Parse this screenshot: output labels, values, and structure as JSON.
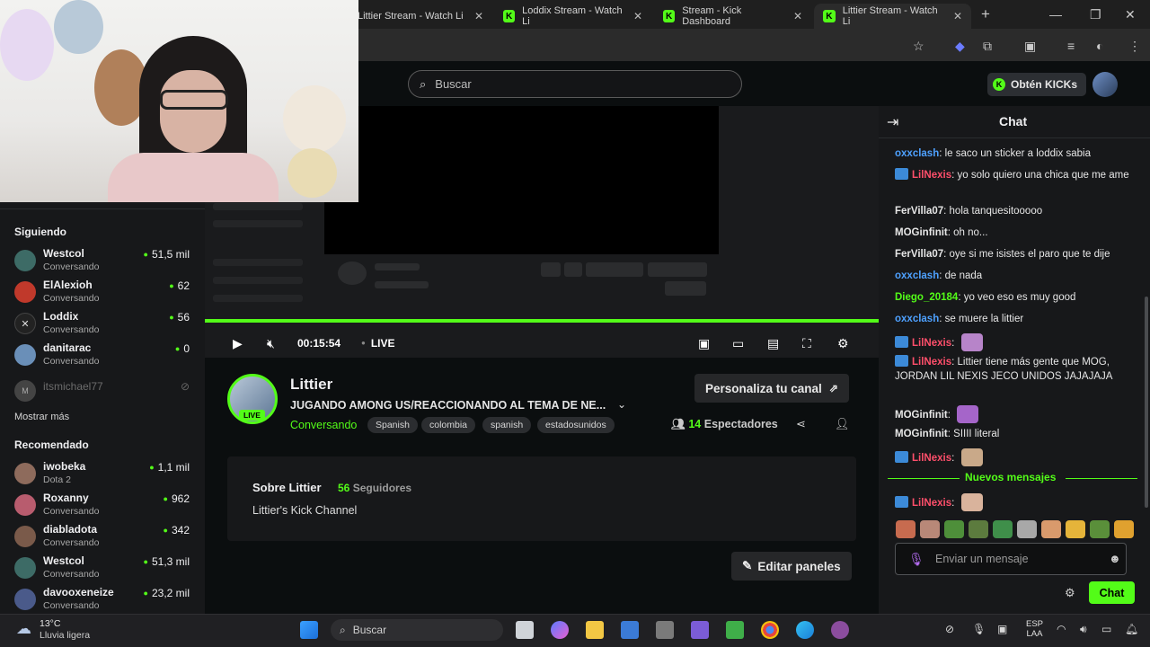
{
  "browser": {
    "tabs": [
      {
        "label": "Littier Stream - Watch Li",
        "active": false
      },
      {
        "label": "Loddix Stream - Watch Li",
        "active": false
      },
      {
        "label": "Stream - Kick Dashboard",
        "active": false
      },
      {
        "label": "Littier Stream - Watch Li",
        "active": true
      }
    ],
    "new_tab": "+",
    "close_glyph": "✕"
  },
  "header": {
    "search_placeholder": "Buscar",
    "kicks_button": "Obtén KICKs"
  },
  "sidebar": {
    "following_title": "Siguiendo",
    "following": [
      {
        "name": "Westcol",
        "category": "Conversando",
        "viewers": "51,5 mil",
        "color": "#3d6b66"
      },
      {
        "name": "ElAlexioh",
        "category": "Conversando",
        "viewers": "62",
        "color": "#c0392b"
      },
      {
        "name": "Loddix",
        "category": "Conversando",
        "viewers": "56",
        "color": "#222222"
      },
      {
        "name": "danitarac",
        "category": "Conversando",
        "viewers": "0",
        "color": "#6a8fb8"
      },
      {
        "name": "itsmichael77",
        "category": "",
        "viewers": "",
        "color": "#555555"
      }
    ],
    "show_more": "Mostrar más",
    "recommended_title": "Recomendado",
    "recommended": [
      {
        "name": "iwobeka",
        "category": "Dota 2",
        "viewers": "1,1 mil",
        "color": "#8e6b5c"
      },
      {
        "name": "Roxanny",
        "category": "Conversando",
        "viewers": "962",
        "color": "#b85c6e"
      },
      {
        "name": "diabladota",
        "category": "Conversando",
        "viewers": "342",
        "color": "#7a5a4a"
      },
      {
        "name": "Westcol",
        "category": "Conversando",
        "viewers": "51,3 mil",
        "color": "#3d6b66"
      },
      {
        "name": "davooxeneize",
        "category": "Conversando",
        "viewers": "23,2 mil",
        "color": "#4a5a8a"
      }
    ]
  },
  "player": {
    "time": "00:15:54",
    "live_label": "LIVE"
  },
  "channel": {
    "name": "Littier",
    "live_badge": "LIVE",
    "title": "JUGANDO AMONG US/REACCIONANDO AL TEMA DE NE...",
    "category": "Conversando",
    "tags": [
      "Spanish",
      "colombia",
      "spanish",
      "estadosunidos"
    ],
    "customize_button": "Personaliza tu canal",
    "viewers_count": "14",
    "viewers_label": "Espectadores",
    "about_title": "Sobre Littier",
    "followers_count": "56",
    "followers_label": "Seguidores",
    "description": "Littier's Kick Channel",
    "edit_panels_button": "Editar paneles"
  },
  "chat": {
    "title": "Chat",
    "messages": [
      {
        "user": "oxxclash",
        "text": "le saco un sticker a loddix sabia",
        "color": "#4ea1ff",
        "badge": false
      },
      {
        "user": "LilNexis",
        "text": "yo solo quiero una chica que me ame",
        "color": "#ff4f6b",
        "badge": true
      },
      {
        "user": "FerVilla07",
        "text": "hola tanquesitooooo",
        "color": "#e6e6e6",
        "badge": false
      },
      {
        "user": "MOGinfinit",
        "text": "oh no...",
        "color": "#e6e6e6",
        "badge": false
      },
      {
        "user": "FerVilla07",
        "text": "oye si me isistes el paro que te dije",
        "color": "#e6e6e6",
        "badge": false
      },
      {
        "user": "oxxclash",
        "text": "de nada",
        "color": "#4ea1ff",
        "badge": false
      },
      {
        "user": "Diego_20184",
        "text": "yo veo eso es muy good",
        "color": "#53fc18",
        "badge": false
      },
      {
        "user": "oxxclash",
        "text": "se muere la littier",
        "color": "#4ea1ff",
        "badge": false
      },
      {
        "user": "LilNexis",
        "text": "",
        "color": "#ff4f6b",
        "badge": true
      },
      {
        "user": "LilNexis",
        "text": "Littier tiene más gente que MOG, JORDAN LIL NEXIS JECO UNIDOS JAJAJAJA",
        "color": "#ff4f6b",
        "badge": true
      },
      {
        "user": "MOGinfinit",
        "text": "",
        "color": "#e6e6e6",
        "badge": false
      },
      {
        "user": "MOGinfinit",
        "text": "SIIII literal",
        "color": "#e6e6e6",
        "badge": false
      },
      {
        "user": "LilNexis",
        "text": "",
        "color": "#ff4f6b",
        "badge": true
      },
      {
        "user": "LilNexis",
        "text": "",
        "color": "#ff4f6b",
        "badge": true
      }
    ],
    "new_messages": "Nuevos mensajes",
    "input_placeholder": "Enviar un mensaje",
    "send_button": "Chat"
  },
  "taskbar": {
    "temperature": "13°C",
    "weather": "Lluvia ligera",
    "search_placeholder": "Buscar",
    "lang_line1": "ESP",
    "lang_line2": "LAA"
  }
}
